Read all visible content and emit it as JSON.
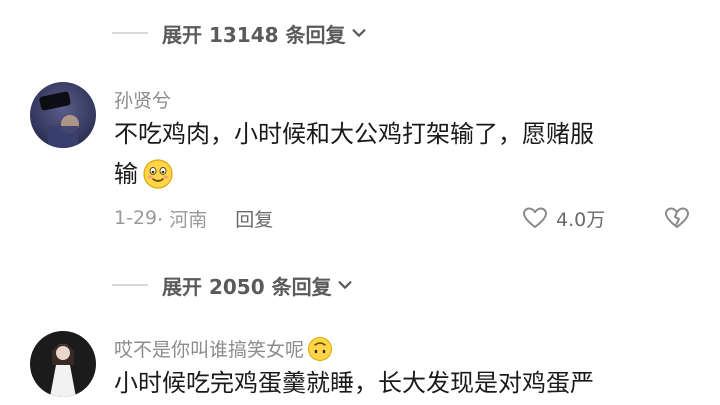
{
  "expand_top": {
    "label": "展开 13148 条回复"
  },
  "comment1": {
    "username": "孙贤兮",
    "text_line1": "不吃鸡肉，小时候和大公鸡打架输了，愿赌服",
    "text_line2": "输",
    "emoji": "smiling-face-emoji",
    "date": "1-29",
    "location": "· 河南",
    "reply_label": "回复",
    "likes": "4.0万"
  },
  "expand_mid": {
    "label": "展开 2050 条回复"
  },
  "comment2": {
    "username": "哎不是你叫谁搞笑女呢",
    "emoji": "upside-down-face-emoji",
    "text_line1": "小时候吃完鸡蛋羹就睡，长大发现是对鸡蛋严"
  },
  "colors": {
    "meta_gray": "#9a9a9a",
    "text": "#1a1a1a",
    "divider": "#d9d9d9"
  }
}
